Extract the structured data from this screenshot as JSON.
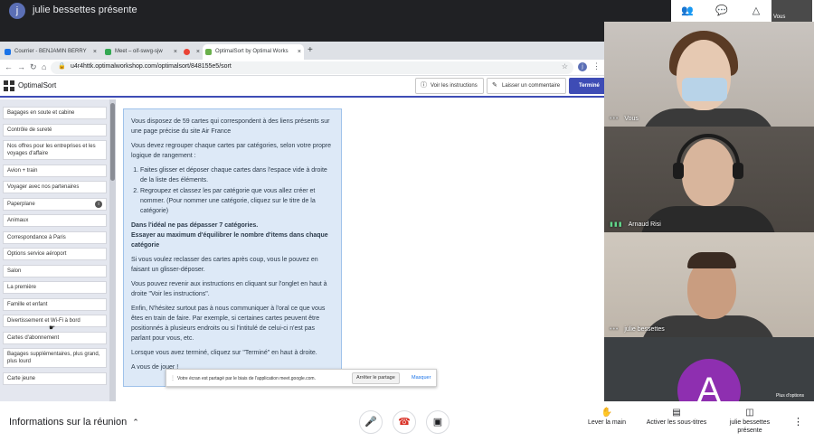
{
  "meet": {
    "presenter_initial": "j",
    "presenter_title": "julie bessettes présente",
    "self_label": "Vous",
    "more_options": "Plus d'options"
  },
  "browser": {
    "tabs": [
      {
        "label": "Courrier - BENJAMIN BERRY",
        "color": "#1a73e8"
      },
      {
        "label": "Meet – oif-swvg-sjw",
        "color": "#34a853"
      },
      {
        "label": "",
        "color": "#ea4335"
      },
      {
        "label": "OptimalSort by Optimal Works",
        "color": "#6ab04c"
      }
    ],
    "new_tab": "+",
    "url": "u4r4httk.optimalworkshop.com/optimalsort/848155e5/sort",
    "profile_initial": "j"
  },
  "app": {
    "name": "OptimalSort",
    "instructions_button": "Voir les instructions",
    "comment_button": "Laisser un commentaire",
    "done_button": "Terminé"
  },
  "cards": [
    {
      "label": "Bagages en soute et cabine"
    },
    {
      "label": "Contrôle de sureté"
    },
    {
      "label": "Nos offres pour les entreprises et les voyages d'affaire"
    },
    {
      "label": "Avion + train"
    },
    {
      "label": "Voyager avec nos partenaires"
    },
    {
      "label": "Paperplane",
      "info": "i"
    },
    {
      "label": "Animaux"
    },
    {
      "label": "Correspondance à Paris"
    },
    {
      "label": "Options service aéroport"
    },
    {
      "label": "Salon"
    },
    {
      "label": "La première"
    },
    {
      "label": "Famille et enfant"
    },
    {
      "label": "Divertissement et Wi-Fi à bord"
    },
    {
      "label": "Cartes d'abonnement"
    },
    {
      "label": "Bagages supplémentaires, plus grand, plus lourd"
    },
    {
      "label": "Carte jeune"
    }
  ],
  "instructions": {
    "p1": "Vous disposez de 59 cartes qui correspondent à des liens présents sur une page précise du site Air France",
    "p2": "Vous devez regrouper chaque cartes par catégories, selon votre propre logique de rangement :",
    "li1": "Faites glisser et déposer chaque cartes dans l'espace vide à droite de la liste des éléments.",
    "li2": "Regroupez et classez les par catégorie que vous allez créer et nommer. (Pour nommer une catégorie, cliquez sur le titre de la catégorie)",
    "bold1": "Dans l'idéal ne pas dépasser 7 catégories.",
    "bold2": "Essayer au maximum d'équilibrer le nombre d'items dans chaque catégorie",
    "p3": "Si vous voulez reclasser des cartes après coup, vous le pouvez en faisant un glisser-déposer.",
    "p4": "Vous pouvez revenir aux instructions en cliquant sur l'onglet en haut à droite \"Voir les instructions\".",
    "p5": "Enfin, N'hésitez surtout pas à nous communiquer à l'oral ce que vous êtes en train de faire. Par exemple, si certaines cartes peuvent être positionnés à plusieurs endroits ou si l'intitulé de celui-ci n'est pas parlant pour vous, etc.",
    "p6": "Lorsque vous avez terminé, cliquez sur \"Terminé\" en haut à droite.",
    "p7": "A vous de jouer !"
  },
  "sharebar": {
    "message": "Votre écran est partagé par le biais de l'application meet.google.com.",
    "stop": "Arrêter le partage",
    "hide": "Masquer"
  },
  "participants": [
    {
      "name": "Vous"
    },
    {
      "name": "Arnaud Risi"
    },
    {
      "name": "julie bessettes"
    },
    {
      "initial": "A"
    }
  ],
  "bottom": {
    "meeting_info": "Informations sur la réunion",
    "raise_hand": "Lever la main",
    "subtitles": "Activer les sous-titres",
    "presenting": "julie bessettes présente"
  }
}
